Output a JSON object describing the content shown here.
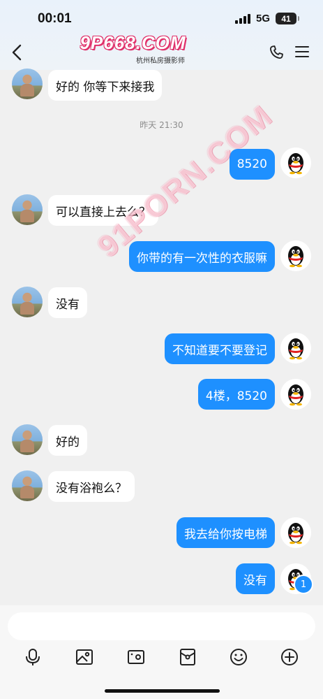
{
  "status_bar": {
    "time": "00:01",
    "network": "5G",
    "battery": "41"
  },
  "header": {
    "logo_text": "9P668.COM",
    "subtitle": "杭州私房摄影师",
    "icons": [
      "back-icon",
      "phone-icon",
      "menu-icon"
    ]
  },
  "watermark": "91PORN.COM",
  "chat": {
    "timestamp": "昨天 21:30",
    "messages": [
      {
        "side": "in",
        "text": "好的 你等下来接我"
      },
      {
        "side": "out",
        "text": "8520"
      },
      {
        "side": "in",
        "text": "可以直接上去么？"
      },
      {
        "side": "out",
        "text": "你带的有一次性的衣服嘛"
      },
      {
        "side": "in",
        "text": "没有"
      },
      {
        "side": "out",
        "text": "不知道要不要登记"
      },
      {
        "side": "out",
        "text": "4楼，8520"
      },
      {
        "side": "in",
        "text": "好的"
      },
      {
        "side": "in",
        "text": "没有浴袍么？"
      },
      {
        "side": "out",
        "text": "我去给你按电梯"
      },
      {
        "side": "out",
        "text": "没有"
      }
    ],
    "unread_count": "1"
  },
  "input": {
    "placeholder": ""
  },
  "toolbar": [
    "microphone-icon",
    "image-icon",
    "video-icon",
    "red-packet-icon",
    "emoji-icon",
    "plus-icon"
  ],
  "colors": {
    "outgoing_bubble": "#1e90ff",
    "incoming_bubble": "#ffffff",
    "background": "#f0f0f0"
  }
}
